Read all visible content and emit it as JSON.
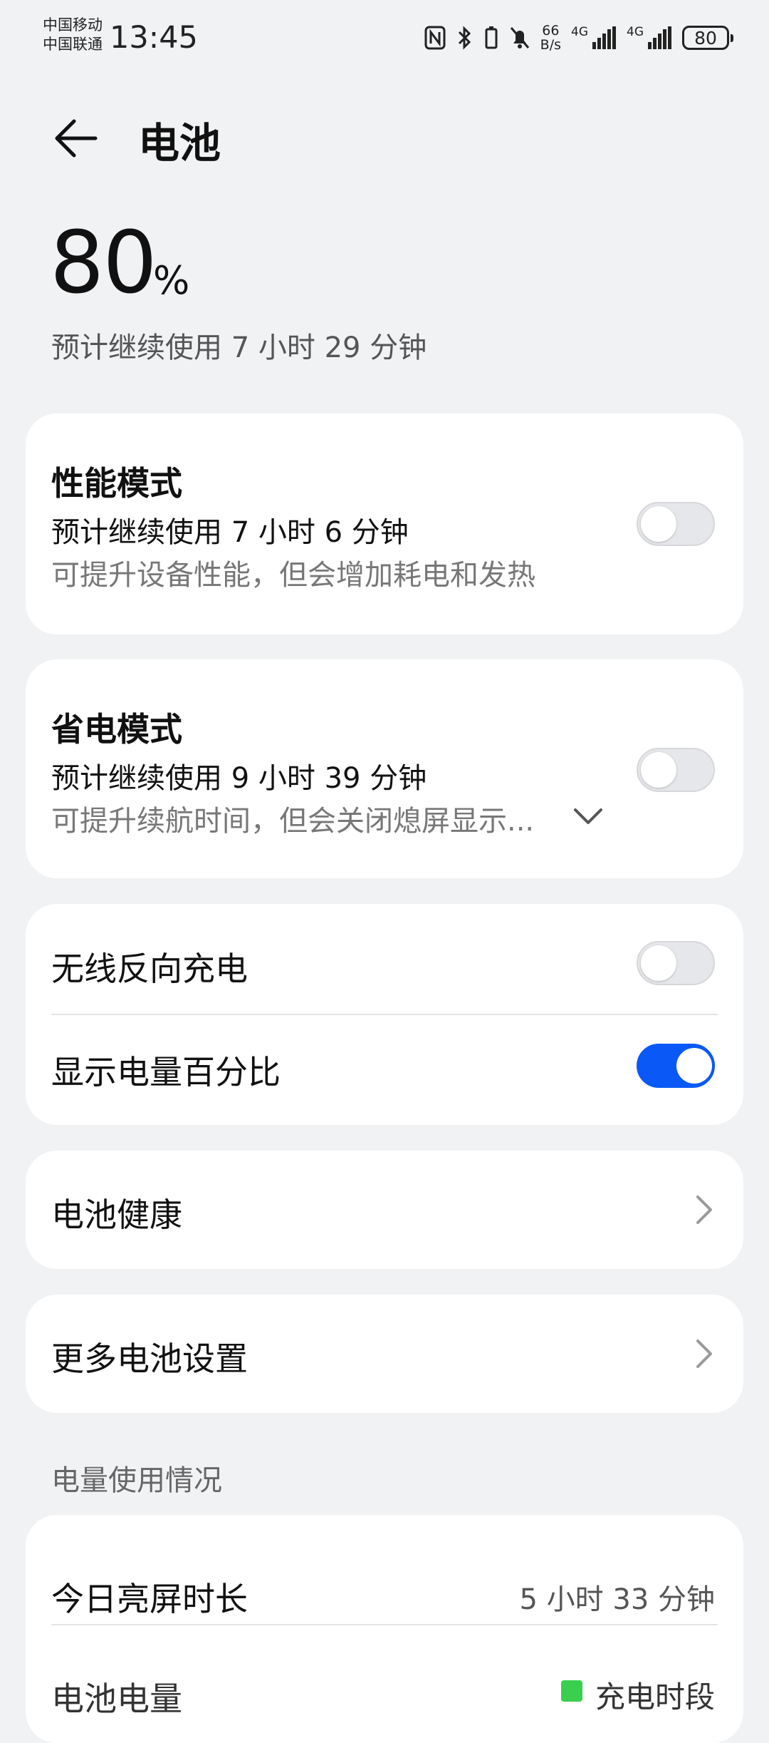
{
  "status_bar": {
    "carrier1": "中国移动",
    "carrier2": "中国联通",
    "time": "13:45",
    "net_speed_value": "66",
    "net_speed_unit": "B/s",
    "sim1_network": "4G",
    "sim2_network": "4G",
    "battery_level": "80"
  },
  "header": {
    "title": "电池"
  },
  "battery": {
    "percent": "80",
    "percent_sign": "%",
    "remaining": "预计继续使用 7 小时 29 分钟"
  },
  "performance_mode": {
    "title": "性能模式",
    "subtitle": "预计继续使用 7 小时 6 分钟",
    "description": "可提升设备性能，但会增加耗电和发热",
    "enabled": false
  },
  "power_saving_mode": {
    "title": "省电模式",
    "subtitle": "预计继续使用 9 小时 39 分钟",
    "description": "可提升续航时间，但会关闭熄屏显示...",
    "enabled": false
  },
  "toggles": [
    {
      "label": "无线反向充电",
      "enabled": false
    },
    {
      "label": "显示电量百分比",
      "enabled": true
    }
  ],
  "battery_health": {
    "label": "电池健康"
  },
  "more_settings": {
    "label": "更多电池设置"
  },
  "usage": {
    "section_label": "电量使用情况",
    "screen_time_label": "今日亮屏时长",
    "screen_time_value": "5 小时 33 分钟",
    "battery_level_label": "电池电量",
    "legend_charging": "充电时段",
    "legend_color": "#3bcf4f"
  },
  "colors": {
    "accent": "#0a59f7",
    "background": "#f1f2f4"
  }
}
